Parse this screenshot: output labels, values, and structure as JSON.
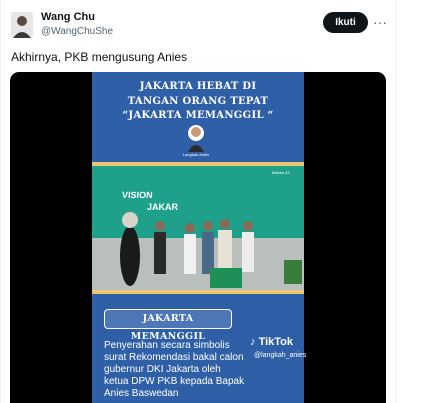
{
  "tweet": {
    "author_name": "Wang Chu",
    "author_handle": "@WangChuShe",
    "follow_label": "Ikuti",
    "text": "Akhirnya, PKB mengusung Anies"
  },
  "media": {
    "poster_title_line1": "JAKARTA HEBAT DI",
    "poster_title_line2": "TANGAN ORANG TEPAT",
    "poster_title_line3": "“JAKARTA MEMANGGIL “",
    "presenter_label": "Langkah Anies",
    "banner_text_1": "VISION",
    "banner_text_2": "JAKAR",
    "stage_sign": "Mabes 43",
    "tag_label": "JAKARTA MEMANGGIL",
    "caption_line1": "Penyerahan secara simbolis",
    "caption_line2": "surat Rekomendasi bakal calon",
    "caption_line3": "gubernur DKI Jakarta oleh",
    "caption_line4": "ketua DPW PKB kepada Bapak",
    "caption_line5": "Anies Baswedan",
    "tiktok_label": "TikTok",
    "tiktok_handle": "@langkah_anies"
  },
  "colors": {
    "poster_blue": "#2f60a7",
    "follow_button": "#0f1419",
    "banner_green": "#1fa08a"
  },
  "icons": {
    "more": "more-horizontal-icon",
    "tiktok": "tiktok-logo-icon"
  }
}
